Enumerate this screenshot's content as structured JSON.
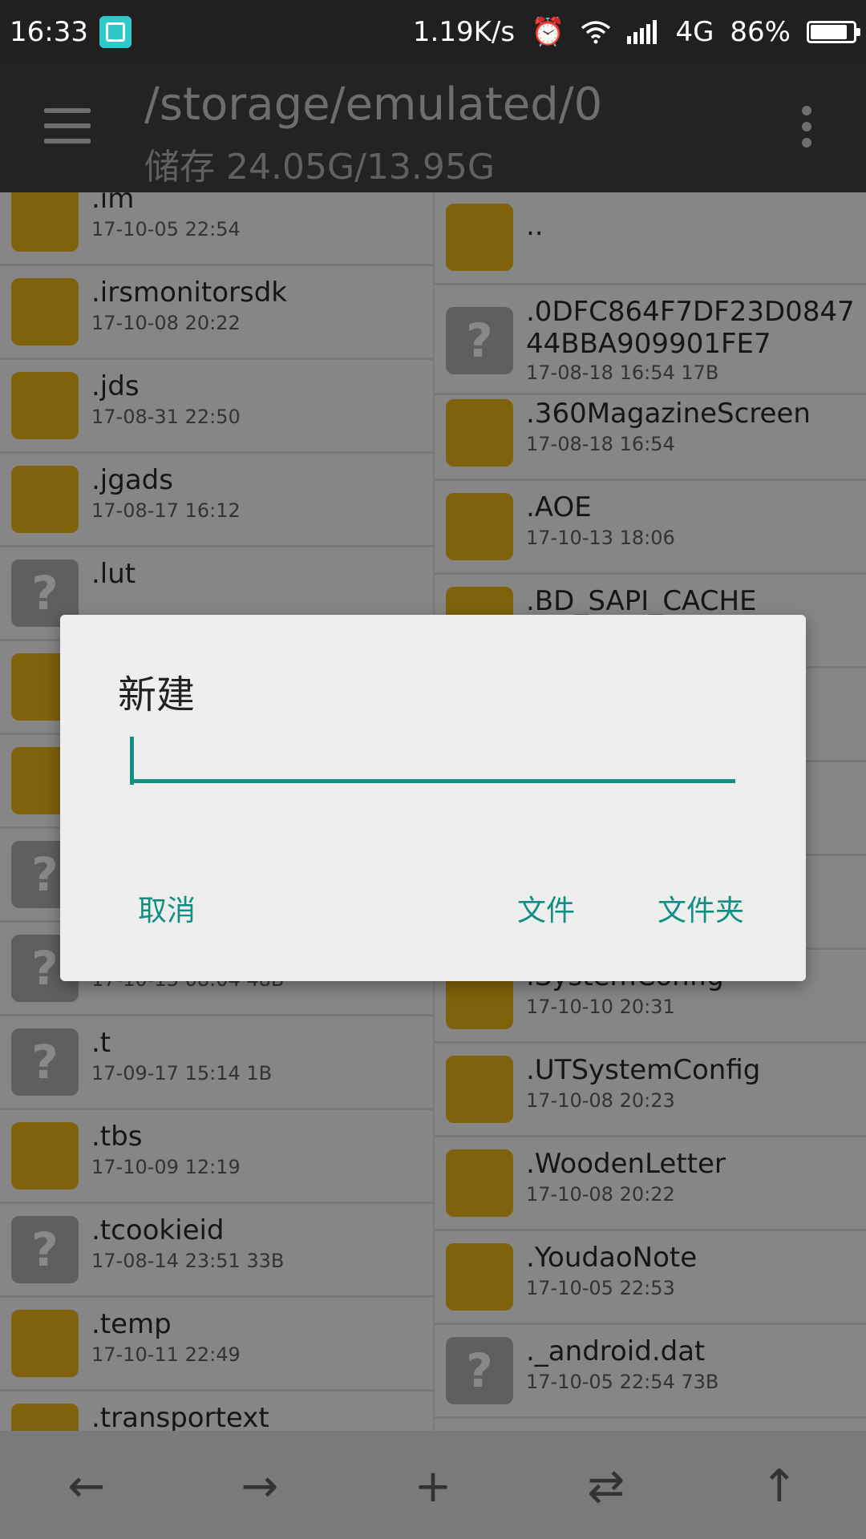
{
  "status_bar": {
    "time": "16:33",
    "speed": "1.19K/s",
    "network": "4G",
    "battery": "86%",
    "battery_level": 0.86
  },
  "app_bar": {
    "path": "/storage/emulated/0",
    "storage": "储存 24.05G/13.95G"
  },
  "left_items": [
    {
      "name": ".im",
      "meta": "17-10-05 22:54",
      "type": "folder"
    },
    {
      "name": ".irsmonitorsdk",
      "meta": "17-10-08 20:22",
      "type": "folder"
    },
    {
      "name": ".jds",
      "meta": "17-08-31 22:50",
      "type": "folder"
    },
    {
      "name": ".jgads",
      "meta": "17-08-17 16:12",
      "type": "folder"
    },
    {
      "name": ".lut",
      "meta": "",
      "type": "unknown"
    },
    {
      "name": "",
      "meta": "",
      "type": "folder"
    },
    {
      "name": "",
      "meta": "",
      "type": "folder"
    },
    {
      "name": "",
      "meta": "",
      "type": "unknown"
    },
    {
      "name": "",
      "meta": "17-10-13 08:04  48B",
      "type": "unknown"
    },
    {
      "name": ".t",
      "meta": "17-09-17 15:14  1B",
      "type": "unknown"
    },
    {
      "name": ".tbs",
      "meta": "17-10-09 12:19",
      "type": "folder"
    },
    {
      "name": ".tcookieid",
      "meta": "17-08-14 23:51  33B",
      "type": "unknown"
    },
    {
      "name": ".temp",
      "meta": "17-10-11 22:49",
      "type": "folder"
    },
    {
      "name": ".transportext",
      "meta": "",
      "type": "folder"
    }
  ],
  "right_items": [
    {
      "name": "..",
      "meta": "",
      "type": "folder"
    },
    {
      "name": ".0DFC864F7DF23D084744BBA909901FE7",
      "meta": "17-08-18 16:54  17B",
      "type": "unknown"
    },
    {
      "name": ".360MagazineScreen",
      "meta": "17-08-18 16:54",
      "type": "folder"
    },
    {
      "name": ".AOE",
      "meta": "17-10-13 18:06",
      "type": "folder"
    },
    {
      "name": ".BD_SAPI_CACHE",
      "meta": "",
      "type": "folder"
    },
    {
      "name": "",
      "meta": "",
      "type": "folder"
    },
    {
      "name": "",
      "meta": "",
      "type": "folder"
    },
    {
      "name": "",
      "meta": "",
      "type": "folder"
    },
    {
      "name": ".SystemConfig",
      "meta": "17-10-10 20:31",
      "type": "folder"
    },
    {
      "name": ".UTSystemConfig",
      "meta": "17-10-08 20:23",
      "type": "folder"
    },
    {
      "name": ".WoodenLetter",
      "meta": "17-10-08 20:22",
      "type": "folder"
    },
    {
      "name": ".YoudaoNote",
      "meta": "17-10-05 22:53",
      "type": "folder"
    },
    {
      "name": "._android.dat",
      "meta": "17-10-05 22:54  73B",
      "type": "unknown"
    }
  ],
  "bottom_bar": {
    "back": "←",
    "forward": "→",
    "add": "+",
    "swap": "⇄",
    "up": "↑"
  },
  "dialog": {
    "title": "新建",
    "input_value": "",
    "cancel": "取消",
    "file": "文件",
    "folder": "文件夹"
  },
  "colors": {
    "accent": "#128e82",
    "folder": "#80620c",
    "unknown": "#5f5f5f"
  }
}
